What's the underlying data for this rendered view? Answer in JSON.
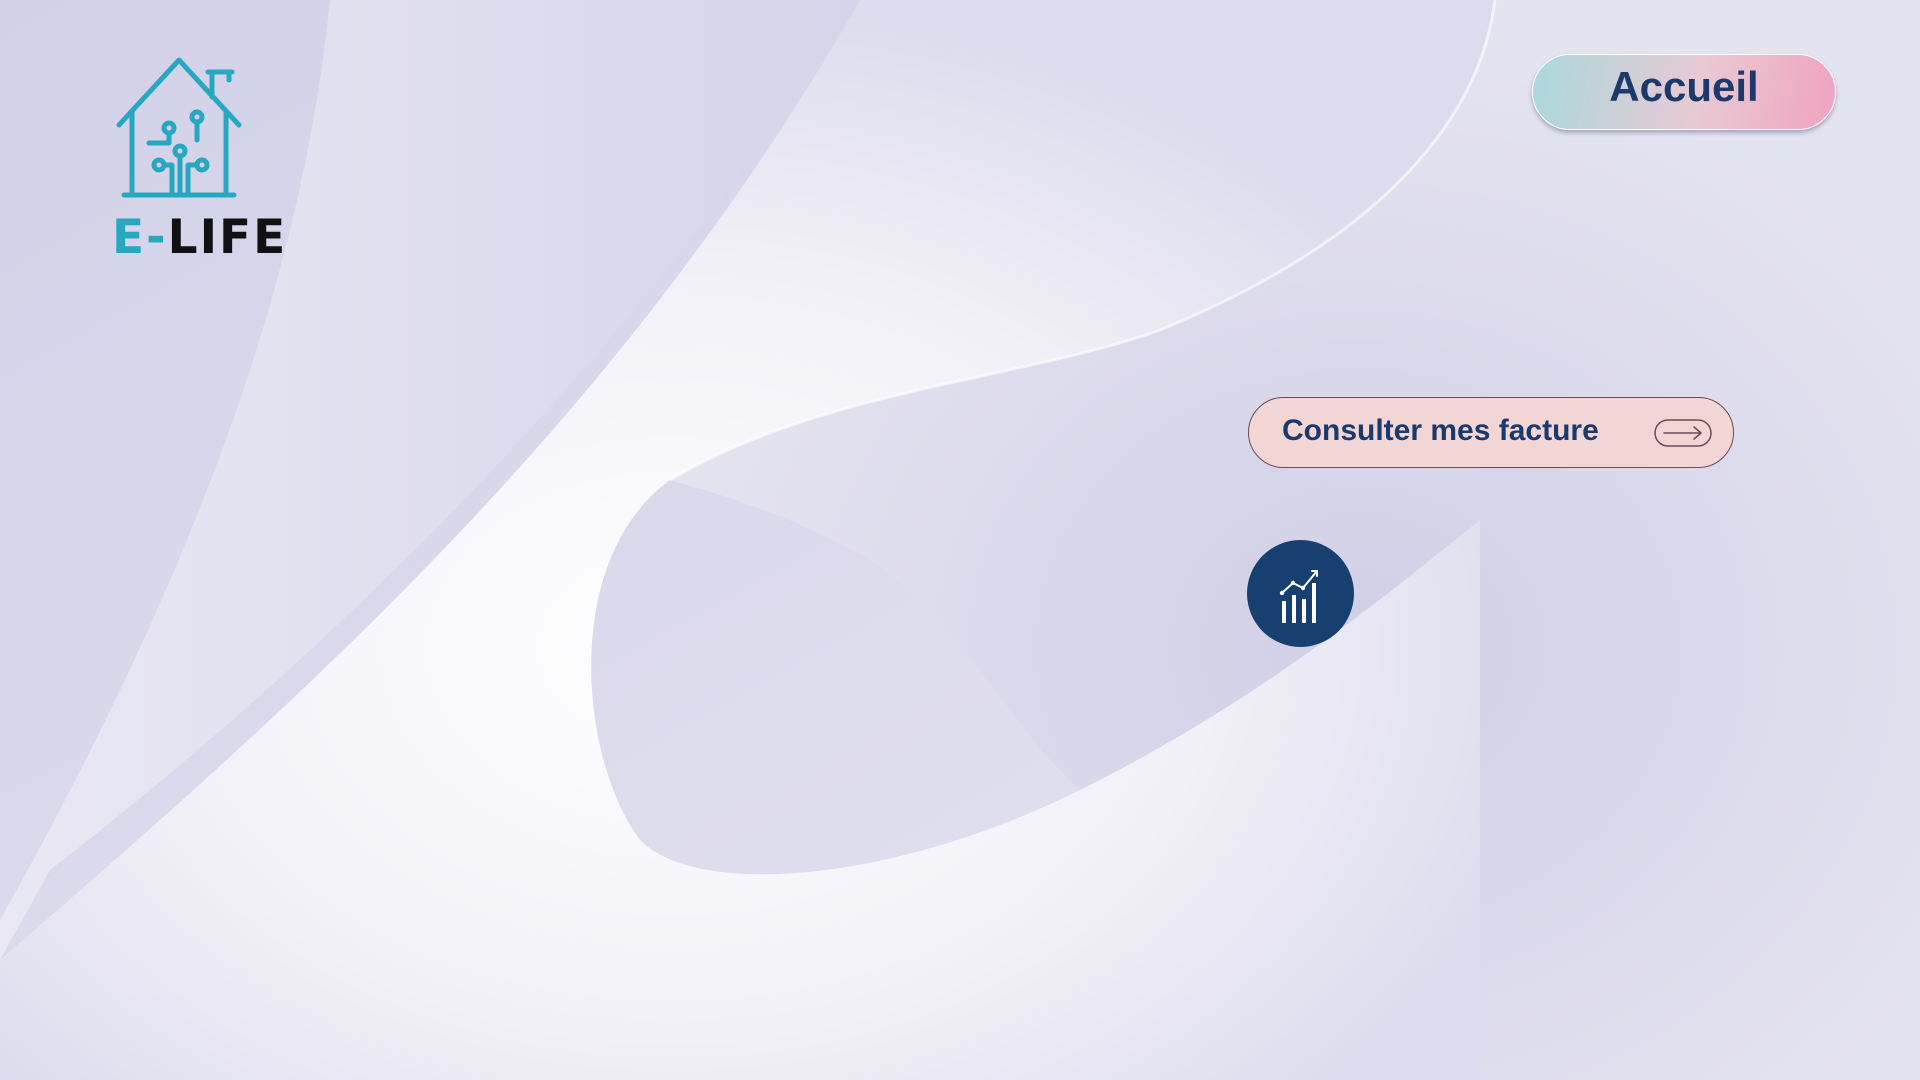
{
  "logo": {
    "brand_prefix": "E-",
    "brand_suffix": "LIFE",
    "icon": "smart-house-icon",
    "colors": {
      "teal": "#27a8c0",
      "dark": "#111111"
    }
  },
  "nav": {
    "home_label": "Accueil"
  },
  "actions": {
    "invoices_label": "Consulter mes facture",
    "invoices_icon": "arrow-right-icon",
    "stats_icon": "bar-chart-trend-icon"
  },
  "colors": {
    "navy": "#1b3a6b",
    "circle": "#173f6f",
    "invoice_button_bg": "#f2d6d6",
    "background": "#d3d2e8"
  }
}
